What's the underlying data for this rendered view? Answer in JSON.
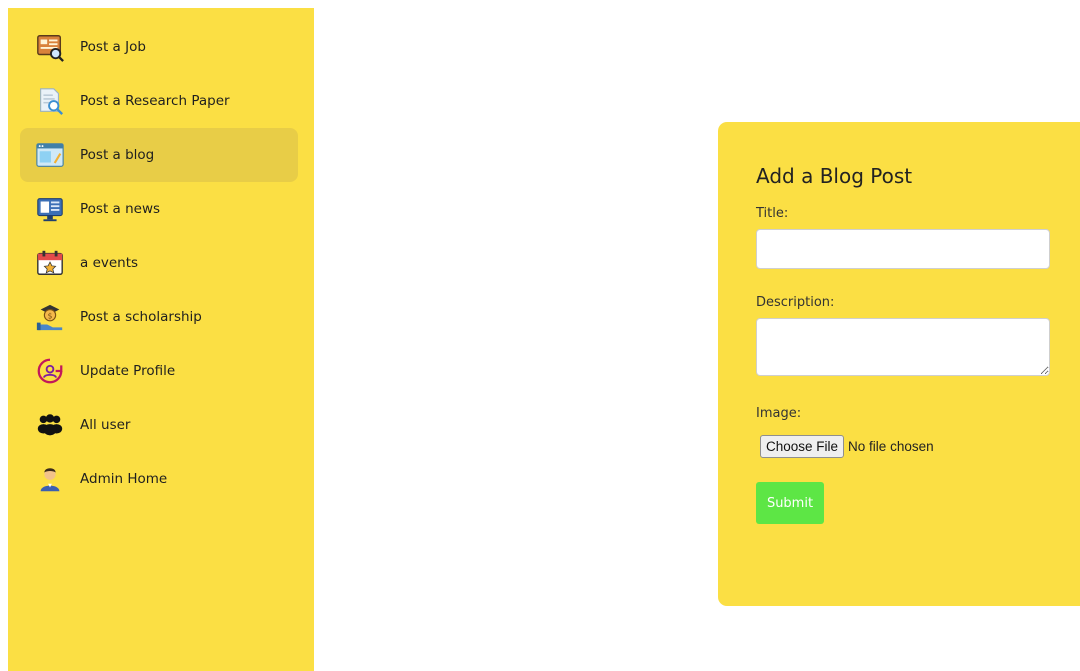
{
  "sidebar": {
    "items": [
      {
        "label": "Post a Job",
        "icon": "job-board-icon"
      },
      {
        "label": "Post a Research Paper",
        "icon": "research-paper-icon"
      },
      {
        "label": "Post a blog",
        "icon": "blog-icon",
        "active": true
      },
      {
        "label": "Post a news",
        "icon": "news-icon"
      },
      {
        "label": "a events",
        "icon": "calendar-icon"
      },
      {
        "label": "Post a scholarship",
        "icon": "scholarship-icon"
      },
      {
        "label": "Update Profile",
        "icon": "update-profile-icon"
      },
      {
        "label": "All user",
        "icon": "users-group-icon"
      },
      {
        "label": "Admin Home",
        "icon": "admin-user-icon"
      }
    ]
  },
  "form": {
    "heading": "Add a Blog Post",
    "title_label": "Title:",
    "title_value": "",
    "description_label": "Description:",
    "description_value": "",
    "image_label": "Image:",
    "choose_file_label": "Choose File",
    "file_status": "No file chosen",
    "submit_label": "Submit"
  },
  "colors": {
    "panel_yellow": "#fbdf44",
    "active_item": "#e8cd47",
    "submit_green": "#5de645"
  }
}
